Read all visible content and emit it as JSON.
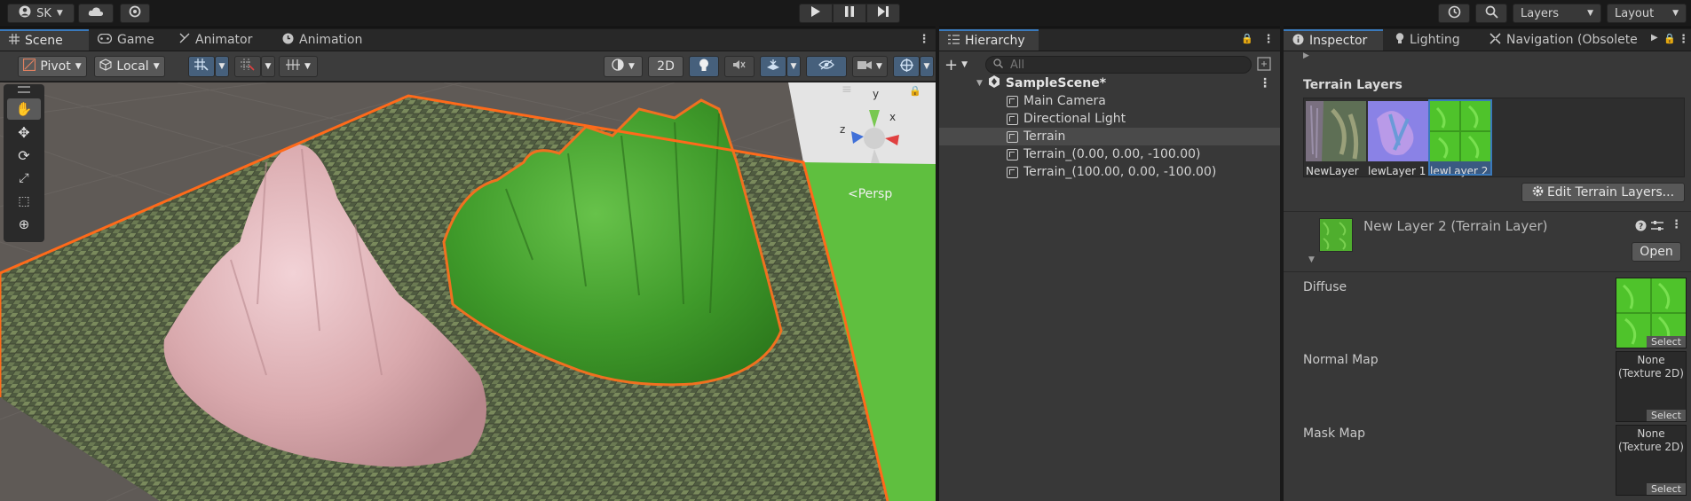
{
  "topbar": {
    "account_label": "SK",
    "layers_label": "Layers",
    "layout_label": "Layout"
  },
  "scene_panel": {
    "tabs": [
      {
        "label": "Scene"
      },
      {
        "label": "Game"
      },
      {
        "label": "Animator"
      },
      {
        "label": "Animation"
      }
    ],
    "pivot_label": "Pivot",
    "local_label": "Local",
    "mode_2d_label": "2D",
    "persp_label": "Persp",
    "gizmo_axes": {
      "y": "y",
      "x": "x",
      "z": "z"
    }
  },
  "hierarchy": {
    "title": "Hierarchy",
    "search_placeholder": "All",
    "scene_name": "SampleScene*",
    "items": [
      {
        "label": "Main Camera"
      },
      {
        "label": "Directional Light"
      },
      {
        "label": "Terrain"
      },
      {
        "label": "Terrain_(0.00, 0.00, -100.00)"
      },
      {
        "label": "Terrain_(100.00, 0.00, -100.00)"
      }
    ]
  },
  "inspector": {
    "tabs": [
      {
        "label": "Inspector"
      },
      {
        "label": "Lighting"
      },
      {
        "label": "Navigation (Obsolete"
      }
    ],
    "section_title": "Terrain Layers",
    "layer_thumbs": [
      {
        "label": "NewLayer"
      },
      {
        "label": "lewLayer 1"
      },
      {
        "label": "lewLayer 2"
      }
    ],
    "edit_layers_label": "Edit Terrain Layers...",
    "layer_name": "New Layer 2 (Terrain Layer)",
    "open_label": "Open",
    "fields": [
      {
        "label": "Diffuse",
        "value": "",
        "button": "Select"
      },
      {
        "label": "Normal Map",
        "value": "None\n(Texture 2D)",
        "button": "Select"
      },
      {
        "label": "Mask Map",
        "value": "None\n(Texture 2D)",
        "button": "Select"
      }
    ]
  },
  "colors": {
    "accent": "#3a79bb",
    "selection_outline": "#ff6a1a",
    "panel_bg": "#383838"
  }
}
